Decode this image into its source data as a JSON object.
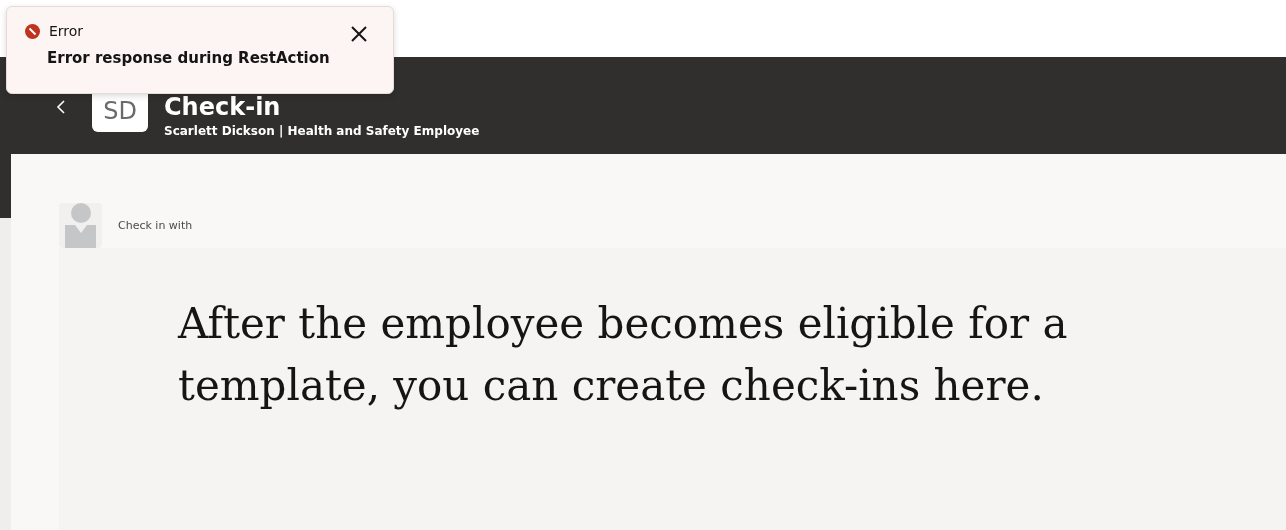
{
  "header": {
    "initials": "SD",
    "title": "Check-in",
    "subtitle": "Scarlett Dickson | Health and Safety Employee"
  },
  "checkin": {
    "label": "Check in with",
    "message": "After the employee becomes eligible for a template, you can create check-ins here."
  },
  "toast": {
    "kind": "error",
    "title": "Error",
    "message": "Error response during RestAction"
  }
}
